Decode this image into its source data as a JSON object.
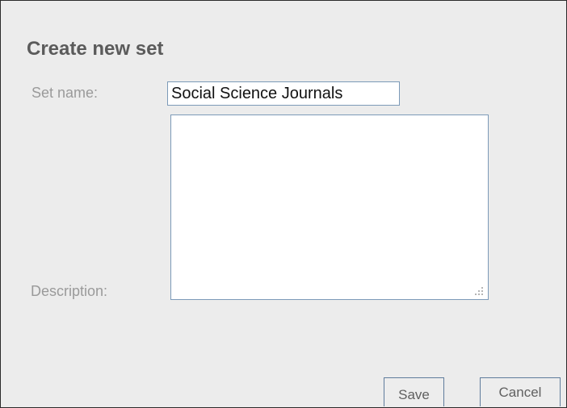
{
  "dialog": {
    "title": "Create new set",
    "set_name_label": "Set name:",
    "set_name_value": "Social Science Journals",
    "description_label": "Description:",
    "description_value": "",
    "save_label": "Save",
    "cancel_label": "Cancel"
  },
  "colors": {
    "background": "#ececec",
    "field_border": "#7c9ab8",
    "label_text": "#9a9a9a",
    "title_text": "#5b5b5b"
  }
}
